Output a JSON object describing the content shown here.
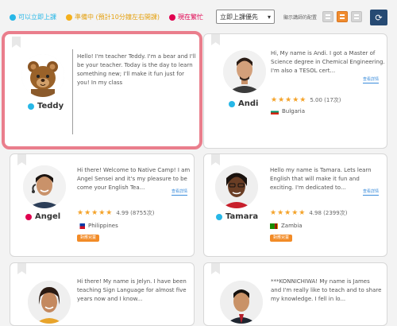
{
  "legend": [
    {
      "label": "可以立即上課",
      "color": "#27b7e7"
    },
    {
      "label": "準備中 (預計10分鐘左右開課)",
      "color": "#f4b01c"
    },
    {
      "label": "現在繁忙",
      "color": "#e0004f"
    }
  ],
  "sort": {
    "selected": "立即上課優先"
  },
  "view": {
    "label": "顯示講師的配置",
    "active": 2
  },
  "teachers": [
    {
      "name": "Teddy",
      "status_color": "#27b7e7",
      "intro": "Hello! I'm teacher Teddy. I'm a bear and I'll be your teacher. Today is the day to learn something new; I'll make it fun just for you! In my class"
    },
    {
      "name": "Andi",
      "status_color": "#27b7e7",
      "intro": "Hi, My name is Andi. I got a Master of Science degree in Chemical Engineering. I'm also a TESOL cert...",
      "more": "查看詳情",
      "rating": "5.00 (17次)",
      "country": "Bulgaria"
    },
    {
      "name": "Angel",
      "status_color": "#e0004f",
      "intro": "Hi there! Welcome to Native Camp! I am Angel Sensei and it's my pleasure to be come your English Tea...",
      "more": "查看詳情",
      "rating": "4.99 (8755次)",
      "country": "Philippines",
      "tag": "對應兒童"
    },
    {
      "name": "Tamara",
      "status_color": "#27b7e7",
      "intro": "Hello my name is Tamara. Lets learn English that will make it fun and exciting. I'm dedicated to...",
      "more": "查看詳情",
      "rating": "4.98 (2399次)",
      "country": "Zambia",
      "tag": "對應兒童"
    },
    {
      "intro": "Hi there! My name is Jelyn. I have been teaching Sign Language for almost five years now and I know..."
    },
    {
      "intro": "***KONNICHIWA! My name is James and I'm really like to teach and to share my knowledge. I fell in lo..."
    }
  ]
}
